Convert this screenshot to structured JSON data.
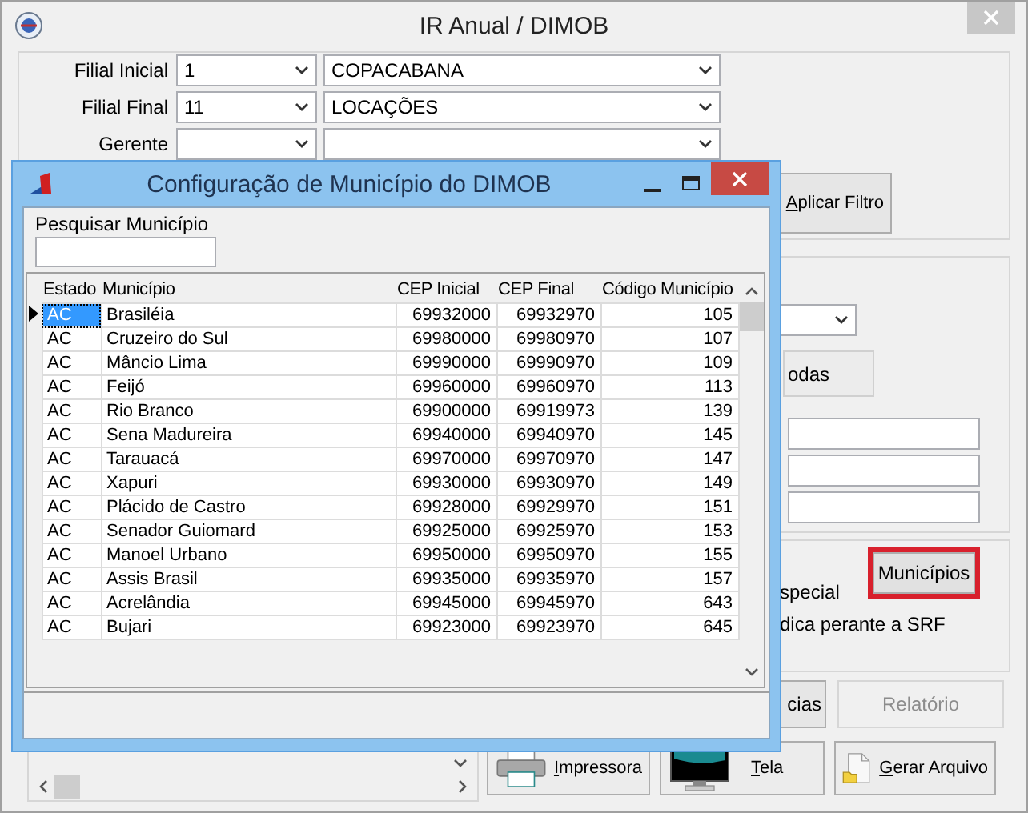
{
  "window": {
    "title": "IR Anual / DIMOB"
  },
  "filters": [
    {
      "label": "Filial Inicial",
      "code": "1",
      "name": "COPACABANA"
    },
    {
      "label": "Filial Final",
      "code": "11",
      "name": "LOCAÇÕES"
    },
    {
      "label": "Gerente"
    }
  ],
  "apply_button": "Aplicar Filtro",
  "partial_button": "odas",
  "municipios_button": {
    "label": "Municípios",
    "highlighted": true
  },
  "option_texts": [
    "special",
    "dica perante a SRF"
  ],
  "action_buttons": [
    {
      "label": "cias",
      "disabled": false
    },
    {
      "label": "Relatório",
      "disabled": true
    }
  ],
  "output_buttons": [
    {
      "label": "Impressora",
      "kind": "printer"
    },
    {
      "label": "Tela",
      "kind": "screen"
    },
    {
      "label": "Gerar Arquivo",
      "kind": "file"
    }
  ],
  "dialog": {
    "title": "Configuração de Município do DIMOB",
    "search_label": "Pesquisar Município",
    "columns": [
      "Estado",
      "Município",
      "CEP Inicial",
      "CEP Final",
      "Código Município"
    ],
    "rows": [
      {
        "cells": [
          "AC",
          "Brasiléia",
          "69932000",
          "69932970",
          "105"
        ],
        "selected": true
      },
      {
        "cells": [
          "AC",
          "Cruzeiro do Sul",
          "69980000",
          "69980970",
          "107"
        ],
        "selected": false
      },
      {
        "cells": [
          "AC",
          "Mâncio Lima",
          "69990000",
          "69990970",
          "109"
        ],
        "selected": false
      },
      {
        "cells": [
          "AC",
          "Feijó",
          "69960000",
          "69960970",
          "113"
        ],
        "selected": false
      },
      {
        "cells": [
          "AC",
          "Rio Branco",
          "69900000",
          "69919973",
          "139"
        ],
        "selected": false
      },
      {
        "cells": [
          "AC",
          "Sena Madureira",
          "69940000",
          "69940970",
          "145"
        ],
        "selected": false
      },
      {
        "cells": [
          "AC",
          "Tarauacá",
          "69970000",
          "69970970",
          "147"
        ],
        "selected": false
      },
      {
        "cells": [
          "AC",
          "Xapuri",
          "69930000",
          "69930970",
          "149"
        ],
        "selected": false
      },
      {
        "cells": [
          "AC",
          "Plácido de Castro",
          "69928000",
          "69929970",
          "151"
        ],
        "selected": false
      },
      {
        "cells": [
          "AC",
          "Senador Guiomard",
          "69925000",
          "69925970",
          "153"
        ],
        "selected": false
      },
      {
        "cells": [
          "AC",
          "Manoel Urbano",
          "69950000",
          "69950970",
          "155"
        ],
        "selected": false
      },
      {
        "cells": [
          "AC",
          "Assis Brasil",
          "69935000",
          "69935970",
          "157"
        ],
        "selected": false
      },
      {
        "cells": [
          "AC",
          "Acrelândia",
          "69945000",
          "69945970",
          "643"
        ],
        "selected": false
      },
      {
        "cells": [
          "AC",
          "Bujari",
          "69923000",
          "69923970",
          "645"
        ],
        "selected": false
      }
    ]
  }
}
